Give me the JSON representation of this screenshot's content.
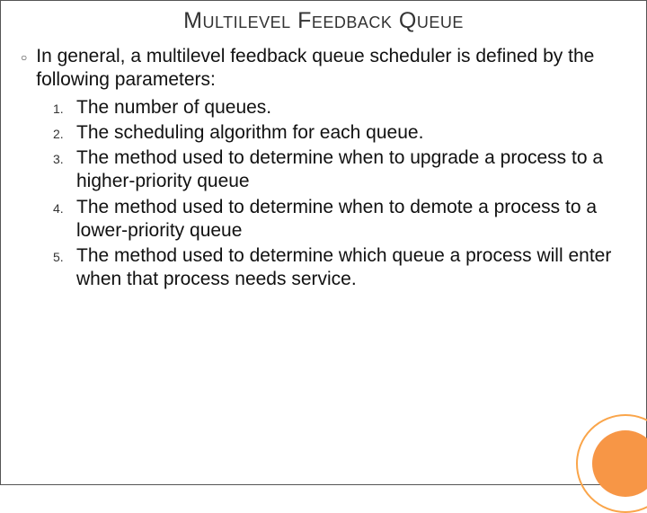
{
  "title": "Multilevel Feedback Queue",
  "intro": "In general, a multilevel feedback queue scheduler is defined by the following parameters:",
  "items": [
    {
      "num": "1.",
      "text": "The number of queues."
    },
    {
      "num": "2.",
      "text": "The scheduling algorithm for each queue."
    },
    {
      "num": "3.",
      "text": "The method used to determine when to upgrade a process to a higher-priority queue"
    },
    {
      "num": "4.",
      "text": "The method used to determine when to demote a process to a lower-priority queue"
    },
    {
      "num": "5.",
      "text": "The method used to determine which queue a process will enter when that process needs service."
    }
  ]
}
